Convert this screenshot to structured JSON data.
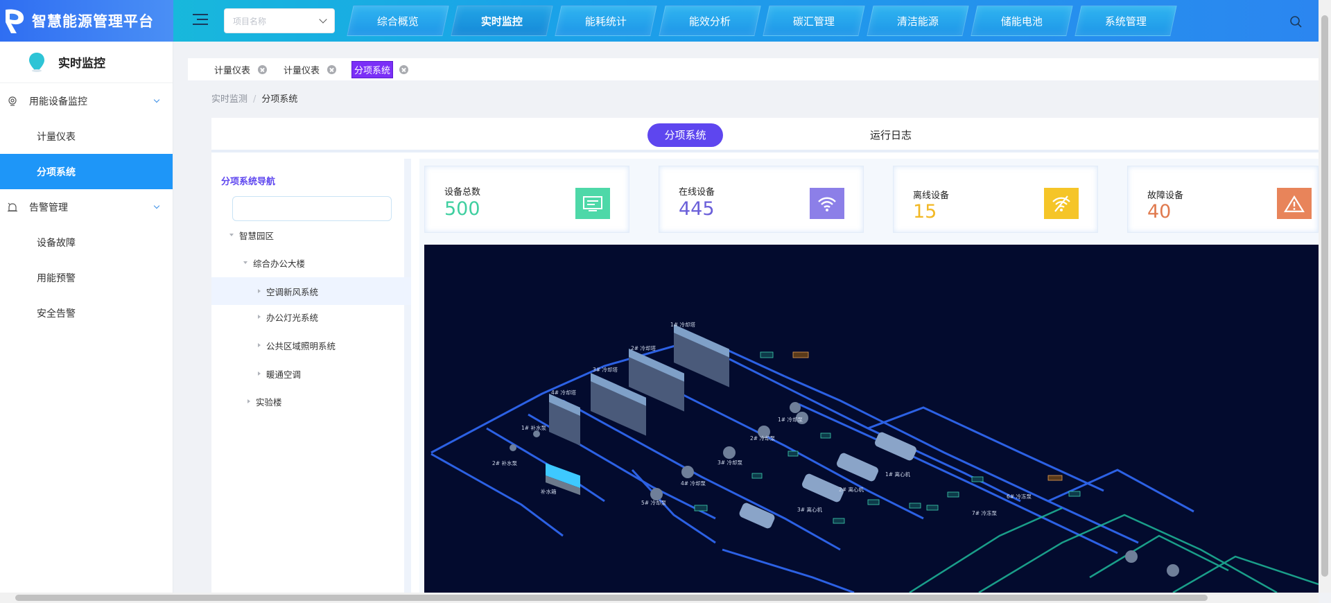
{
  "app": {
    "title": "智慧能源管理平台"
  },
  "header": {
    "project_placeholder": "项目名称",
    "nav": [
      "综合概览",
      "实时监控",
      "能耗统计",
      "能效分析",
      "碳汇管理",
      "清洁能源",
      "储能电池",
      "系统管理"
    ],
    "active_nav": "实时监控"
  },
  "sidebar": {
    "title": "实时监控",
    "groups": [
      {
        "label": "用能设备监控",
        "icon": "monitor-icon",
        "items": [
          "计量仪表",
          "分项系统"
        ]
      },
      {
        "label": "告警管理",
        "icon": "alarm-icon",
        "items": [
          "设备故障",
          "用能预警",
          "安全告警"
        ]
      }
    ],
    "active_item": "分项系统"
  },
  "tabs": [
    "计量仪表",
    "计量仪表",
    "分项系统"
  ],
  "breadcrumb": {
    "parent": "实时监测",
    "separator": "/",
    "current": "分项系统"
  },
  "sub_tabs": [
    "分项系统",
    "运行日志"
  ],
  "tree": {
    "title": "分项系统导航",
    "search_value": "",
    "nodes": {
      "root": "智慧园区",
      "building": "综合办公大楼",
      "sys1": "空调新风系统",
      "sys2": "办公灯光系统",
      "sys3": "公共区域照明系统",
      "sys4": "暖通空调",
      "lab": "实验楼"
    }
  },
  "stats": [
    {
      "label": "设备总数",
      "value": "500",
      "color": "#3fcfa0",
      "icon_bg": "#4ed8a8",
      "icon": "monitor-screen-icon"
    },
    {
      "label": "在线设备",
      "value": "445",
      "color": "#6a5fd9",
      "icon_bg": "#8c7fe8",
      "icon": "wifi-icon"
    },
    {
      "label": "离线设备",
      "value": "15",
      "color": "#f2b824",
      "icon_bg": "#f5c528",
      "icon": "wifi-off-icon"
    },
    {
      "label": "故障设备",
      "value": "40",
      "color": "#e07a4e",
      "icon_bg": "#e8845a",
      "icon": "warning-icon"
    }
  ],
  "diagram": {
    "chillers": [
      "1# 冷却塔",
      "2# 冷却塔",
      "3# 冷却塔",
      "4# 冷却塔"
    ],
    "pumps_cooling": [
      "1# 冷却泵",
      "2# 冷却泵",
      "3# 冷却泵",
      "4# 冷却泵",
      "5# 冷却泵"
    ],
    "makeup_pumps": [
      "1# 补水泵",
      "2# 补水泵"
    ],
    "tank": "补水箱",
    "centrifuges": [
      "1# 离心机",
      "2# 离心机",
      "3# 离心机"
    ],
    "chilled_pumps": [
      "6# 冷冻泵",
      "7# 冷冻泵"
    ]
  }
}
